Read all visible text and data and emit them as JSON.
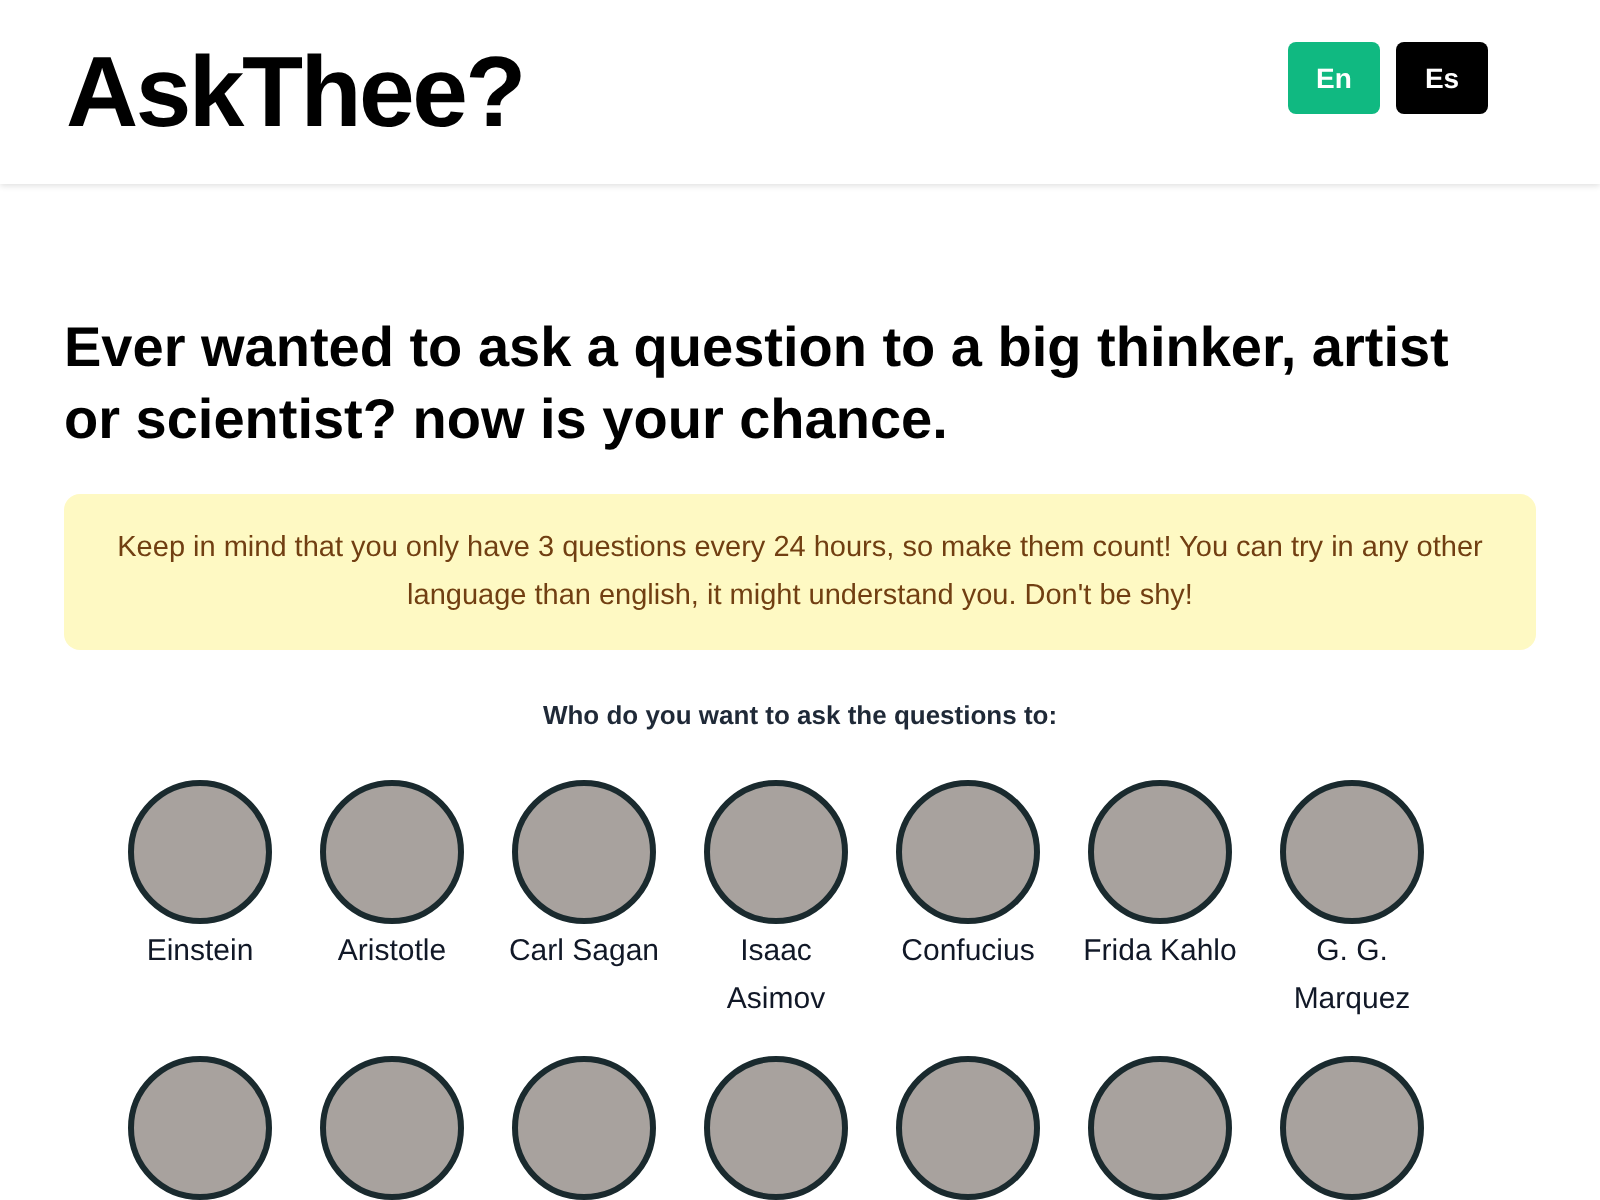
{
  "header": {
    "title": "AskThee?",
    "languages": [
      {
        "label": "En",
        "selected": true
      },
      {
        "label": "Es",
        "selected": false
      }
    ]
  },
  "headline": "Ever wanted to ask a question to a big thinker, artist or scientist? now is your chance.",
  "notice": "Keep in mind that you only have 3 questions every 24 hours, so make them count!  You can try in any other language than english, it might understand you. Don't be shy!",
  "prompt": "Who do you want to ask the questions to:",
  "people": [
    {
      "kind": "labeled",
      "name": "Einstein"
    },
    {
      "kind": "labeled",
      "name": "Aristotle"
    },
    {
      "kind": "labeled",
      "name": "Carl Sagan"
    },
    {
      "kind": "labeled",
      "name": "Isaac Asimov"
    },
    {
      "kind": "labeled",
      "name": "Confucius"
    },
    {
      "kind": "labeled",
      "name": "Frida Kahlo"
    },
    {
      "kind": "labeled",
      "name": "G. G. Marquez"
    },
    {
      "kind": "avatar-only"
    },
    {
      "kind": "avatar-only"
    },
    {
      "kind": "avatar-only"
    },
    {
      "kind": "avatar-only"
    },
    {
      "kind": "avatar-only"
    },
    {
      "kind": "avatar-only"
    },
    {
      "kind": "avatar-only"
    }
  ]
}
